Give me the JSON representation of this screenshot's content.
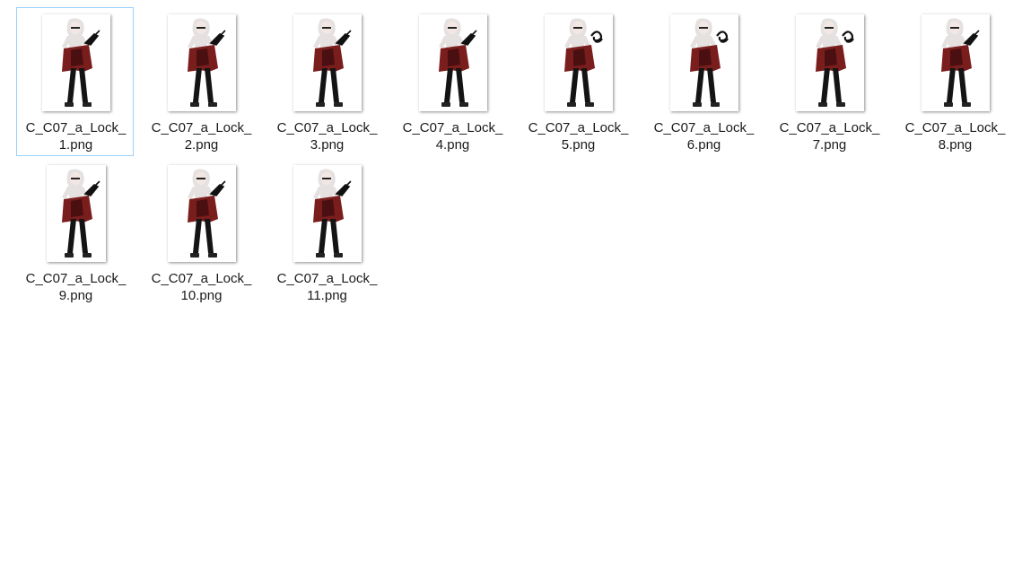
{
  "folder_view": {
    "items": [
      {
        "name_line1": "C_C07_a_Lock_",
        "name_line2": "1.png",
        "selected": true,
        "weapon": "gun"
      },
      {
        "name_line1": "C_C07_a_Lock_",
        "name_line2": "2.png",
        "selected": false,
        "weapon": "gun"
      },
      {
        "name_line1": "C_C07_a_Lock_",
        "name_line2": "3.png",
        "selected": false,
        "weapon": "gun"
      },
      {
        "name_line1": "C_C07_a_Lock_",
        "name_line2": "4.png",
        "selected": false,
        "weapon": "gun"
      },
      {
        "name_line1": "C_C07_a_Lock_",
        "name_line2": "5.png",
        "selected": false,
        "weapon": "swirl"
      },
      {
        "name_line1": "C_C07_a_Lock_",
        "name_line2": "6.png",
        "selected": false,
        "weapon": "swirl"
      },
      {
        "name_line1": "C_C07_a_Lock_",
        "name_line2": "7.png",
        "selected": false,
        "weapon": "swirl"
      },
      {
        "name_line1": "C_C07_a_Lock_",
        "name_line2": "8.png",
        "selected": false,
        "weapon": "gun"
      },
      {
        "name_line1": "C_C07_a_Lock_",
        "name_line2": "9.png",
        "selected": false,
        "weapon": "gun"
      },
      {
        "name_line1": "C_C07_a_Lock_",
        "name_line2": "10.png",
        "selected": false,
        "weapon": "gun"
      },
      {
        "name_line1": "C_C07_a_Lock_",
        "name_line2": "11.png",
        "selected": false,
        "weapon": "gun"
      }
    ]
  },
  "colors": {
    "selection_border": "#99d1ff",
    "coat": "#7a1d1d",
    "coat_dark": "#4a0f10",
    "hair": "#e6e1e1",
    "legs": "#141414",
    "skin": "#f2e7e3"
  }
}
